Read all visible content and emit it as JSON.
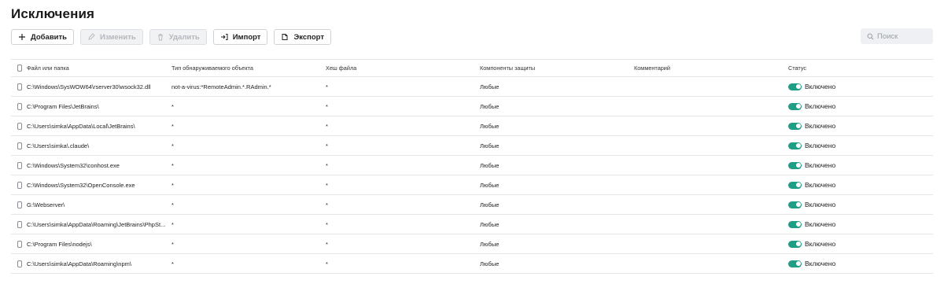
{
  "page": {
    "title": "Исключения"
  },
  "toolbar": {
    "add_label": "Добавить",
    "edit_label": "Изменить",
    "delete_label": "Удалить",
    "import_label": "Импорт",
    "export_label": "Экспорт"
  },
  "search": {
    "placeholder": "Поиск"
  },
  "table": {
    "headers": {
      "path": "Файл или папка",
      "type": "Тип обнаруживаемого объекта",
      "hash": "Хеш файла",
      "components": "Компоненты защиты",
      "comment": "Комментарий",
      "status": "Статус"
    },
    "rows": [
      {
        "path": "C:\\Windows\\SysWOW64\\rserver30\\wsock32.dll",
        "type": "not-a-virus:*RemoteAdmin.*.RAdmin.*",
        "hash": "*",
        "components": "Любые",
        "comment": "",
        "status": "Включено"
      },
      {
        "path": "C:\\Program Files\\JetBrains\\",
        "type": "*",
        "hash": "*",
        "components": "Любые",
        "comment": "",
        "status": "Включено"
      },
      {
        "path": "C:\\Users\\simka\\AppData\\Local\\JetBrains\\",
        "type": "*",
        "hash": "*",
        "components": "Любые",
        "comment": "",
        "status": "Включено"
      },
      {
        "path": "C:\\Users\\simka\\.claude\\",
        "type": "*",
        "hash": "*",
        "components": "Любые",
        "comment": "",
        "status": "Включено"
      },
      {
        "path": "C:\\Windows\\System32\\conhost.exe",
        "type": "*",
        "hash": "*",
        "components": "Любые",
        "comment": "",
        "status": "Включено"
      },
      {
        "path": "C:\\Windows\\System32\\OpenConsole.exe",
        "type": "*",
        "hash": "*",
        "components": "Любые",
        "comment": "",
        "status": "Включено"
      },
      {
        "path": "G:\\Webserver\\",
        "type": "*",
        "hash": "*",
        "components": "Любые",
        "comment": "",
        "status": "Включено"
      },
      {
        "path": "C:\\Users\\simka\\AppData\\Roaming\\JetBrains\\PhpSt...",
        "type": "*",
        "hash": "*",
        "components": "Любые",
        "comment": "",
        "status": "Включено"
      },
      {
        "path": "C:\\Program Files\\nodejs\\",
        "type": "*",
        "hash": "*",
        "components": "Любые",
        "comment": "",
        "status": "Включено"
      },
      {
        "path": "C:\\Users\\simka\\AppData\\Roaming\\npm\\",
        "type": "*",
        "hash": "*",
        "components": "Любые",
        "comment": "",
        "status": "Включено"
      }
    ]
  },
  "colors": {
    "toggle_on": "#1e9e84",
    "disabled_button_bg": "#f1f2f4",
    "row_border": "#e4e6ea"
  },
  "icons": {
    "add": "plus-icon",
    "edit": "pencil-icon",
    "delete": "trash-icon",
    "import": "import-icon",
    "export": "export-icon",
    "search": "search-icon"
  }
}
